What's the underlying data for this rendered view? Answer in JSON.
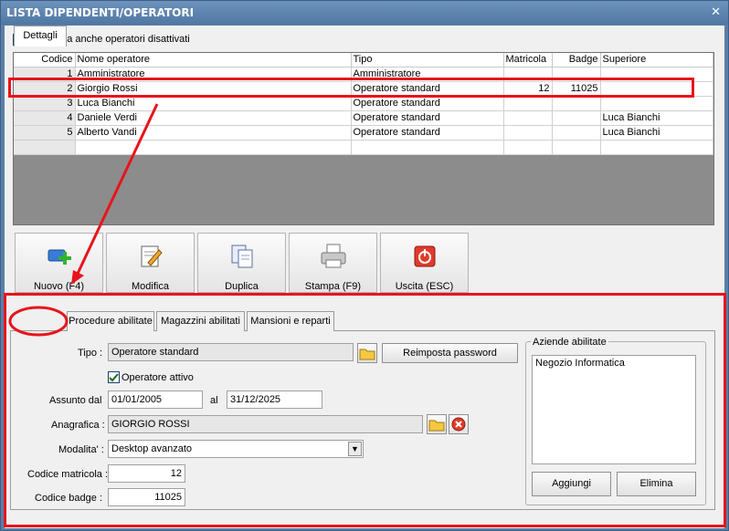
{
  "window": {
    "title": "LISTA DIPENDENTI/OPERATORI",
    "close_glyph": "✕"
  },
  "show_disabled": {
    "label": "Visualizza anche operatori disattivati",
    "checked": false
  },
  "grid": {
    "columns": [
      "Codice",
      "Nome operatore",
      "Tipo",
      "Matricola",
      "Badge",
      "Superiore"
    ],
    "rows": [
      [
        "1",
        "Amministratore",
        "Amministratore",
        "",
        "",
        ""
      ],
      [
        "2",
        "Giorgio Rossi",
        "Operatore standard",
        "12",
        "11025",
        ""
      ],
      [
        "3",
        "Luca Bianchi",
        "Operatore standard",
        "",
        "",
        ""
      ],
      [
        "4",
        "Daniele Verdi",
        "Operatore standard",
        "",
        "",
        "Luca Bianchi"
      ],
      [
        "5",
        "Alberto Vandi",
        "Operatore standard",
        "",
        "",
        "Luca Bianchi"
      ]
    ],
    "selected_row": 1
  },
  "toolbar": {
    "new_label": "Nuovo (F4)",
    "edit_label": "Modifica",
    "duplicate_label": "Duplica",
    "print_label": "Stampa (F9)",
    "exit_label": "Uscita (ESC)"
  },
  "tabs": [
    {
      "label": "Dettagli",
      "active": true
    },
    {
      "label": "Procedure abilitate",
      "active": false
    },
    {
      "label": "Magazzini abilitati",
      "active": false
    },
    {
      "label": "Mansioni e reparti",
      "active": false
    }
  ],
  "details": {
    "tipo_label": "Tipo :",
    "tipo_value": "Operatore standard",
    "reset_password_label": "Reimposta password",
    "active_label": "Operatore attivo",
    "active_checked": true,
    "hired_label": "Assunto dal",
    "hired_from": "01/01/2005",
    "al_label": "al",
    "hired_to": "31/12/2025",
    "anagrafica_label": "Anagrafica :",
    "anagrafica_value": "GIORGIO ROSSI",
    "mode_label": "Modalita' :",
    "mode_value": "Desktop avanzato",
    "matricola_label": "Codice matricola :",
    "matricola_value": "12",
    "badge_label": "Codice badge :",
    "badge_value": "11025"
  },
  "companies": {
    "group_label": "Aziende abilitate",
    "items": [
      "Negozio Informatica"
    ],
    "add_label": "Aggiungi",
    "delete_label": "Elimina"
  },
  "colors": {
    "title_bar": "#5a7fa8",
    "annotation": "#e8141b",
    "selection": "#ffffff"
  }
}
